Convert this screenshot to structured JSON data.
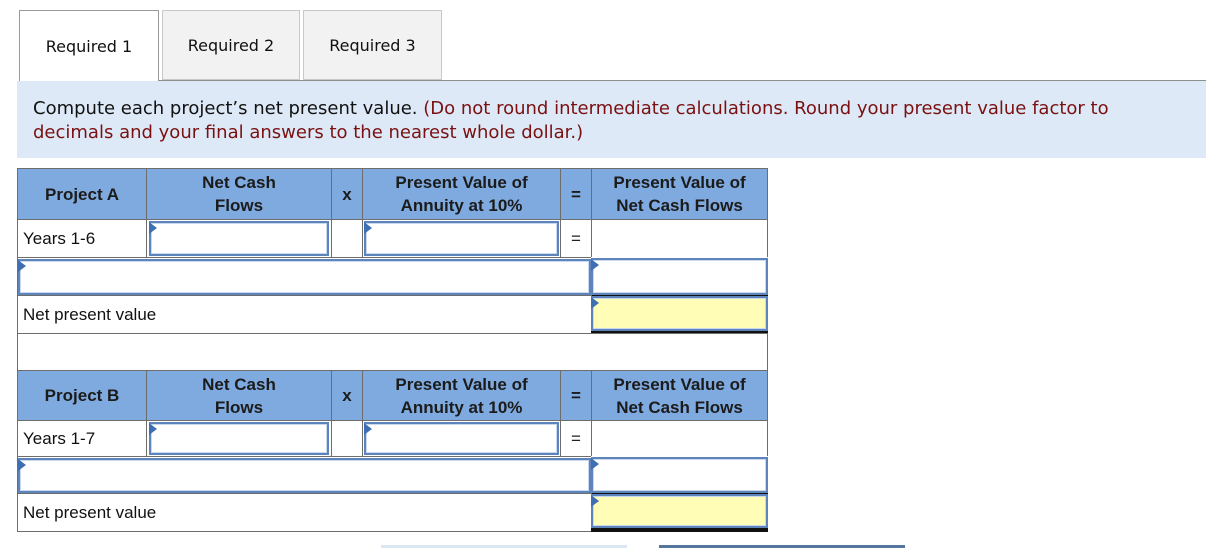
{
  "tabs": [
    {
      "label": "Required 1",
      "active": true
    },
    {
      "label": "Required 2",
      "active": false
    },
    {
      "label": "Required 3",
      "active": false
    }
  ],
  "instruction": {
    "main": "Compute each project’s net present value.",
    "note_line1": "(Do not round intermediate calculations. Round your present value factor to",
    "note_line2": "decimals and your final answers to the nearest whole dollar.)"
  },
  "colors": {
    "header_bg": "#7faadf",
    "instruction_bg": "#dde9f7",
    "note_text": "#7a1010",
    "answer_bg": "#fffdb6",
    "input_border": "#5d84bb"
  },
  "projects": [
    {
      "name": "Project A",
      "headers": {
        "net_cash_flows": "Net Cash Flows",
        "times": "x",
        "pv_annuity": "Present Value of Annuity at 10%",
        "equals": "=",
        "pv_net_cash_flows": "Present Value of Net Cash Flows"
      },
      "row_label": "Years 1-6",
      "row_equals": "=",
      "net_cash_flows_value": "",
      "pv_factor_value": "",
      "pv_result_value": "",
      "extra_label_value": "",
      "extra_amount_value": "",
      "npv_label": "Net present value",
      "npv_value": ""
    },
    {
      "name": "Project B",
      "headers": {
        "net_cash_flows": "Net Cash Flows",
        "times": "x",
        "pv_annuity": "Present Value of Annuity at 10%",
        "equals": "=",
        "pv_net_cash_flows": "Present Value of Net Cash Flows"
      },
      "row_label": "Years 1-7",
      "row_equals": "=",
      "net_cash_flows_value": "",
      "pv_factor_value": "",
      "pv_result_value": "",
      "extra_label_value": "",
      "extra_amount_value": "",
      "npv_label": "Net present value",
      "npv_value": ""
    }
  ]
}
